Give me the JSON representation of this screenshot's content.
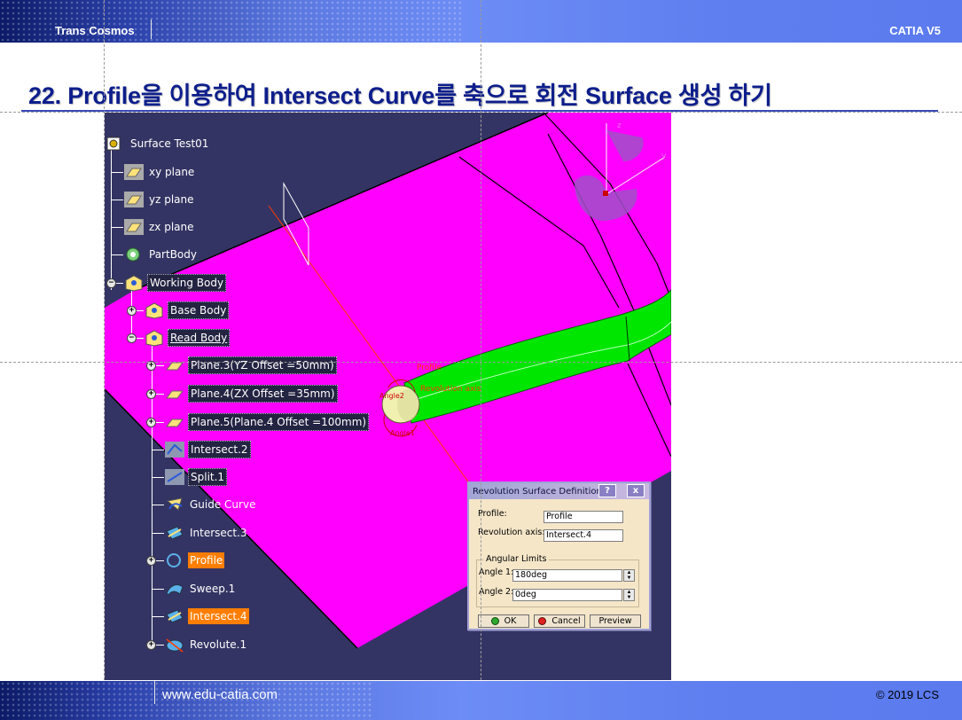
{
  "header": {
    "brand": "Trans Cosmos",
    "product": "CATIA V5"
  },
  "slide": {
    "title": "22. Profile을 이용하여 Intersect Curve를 축으로 회전 Surface 생성 하기"
  },
  "tree": {
    "root": "Surface Test01",
    "items": [
      {
        "label": "xy plane"
      },
      {
        "label": "yz plane"
      },
      {
        "label": "zx plane"
      },
      {
        "label": "PartBody"
      },
      {
        "label": "Working Body"
      },
      {
        "label": "Base Body"
      },
      {
        "label": "Read Body"
      },
      {
        "label": "Plane.3(YZ Offset =50mm)"
      },
      {
        "label": "Plane.4(ZX Offset =35mm)"
      },
      {
        "label": "Plane.5(Plane.4 Offset =100mm)"
      },
      {
        "label": "Intersect.2"
      },
      {
        "label": "Split.1"
      },
      {
        "label": "Guide Curve"
      },
      {
        "label": "Intersect.3"
      },
      {
        "label": "Profile"
      },
      {
        "label": "Sweep.1"
      },
      {
        "label": "Intersect.4"
      },
      {
        "label": "Revolute.1"
      }
    ]
  },
  "viewport": {
    "labels": {
      "profile": "Profile",
      "axis": "Revolution axis",
      "angle1": "Angle1",
      "angle2": "Angle2"
    },
    "compass": {
      "z": "z",
      "y": "y"
    },
    "colors": {
      "background": "#343464",
      "surface": "#ff00ff",
      "tube": "#00e600"
    }
  },
  "dialog": {
    "title": "Revolution Surface Definition",
    "help": "?",
    "close": "x",
    "profile_label": "Profile:",
    "profile_value": "Profile",
    "axis_label": "Revolution axis:",
    "axis_value": "Intersect.4",
    "group_title": "Angular Limits",
    "angle1_label": "Angle 1:",
    "angle1_value": "180deg",
    "angle2_label": "Angle 2:",
    "angle2_value": "0deg",
    "ok": "OK",
    "cancel": "Cancel",
    "preview": "Preview"
  },
  "footer": {
    "url": "www.edu-catia.com",
    "copyright": "© 2019 LCS"
  }
}
